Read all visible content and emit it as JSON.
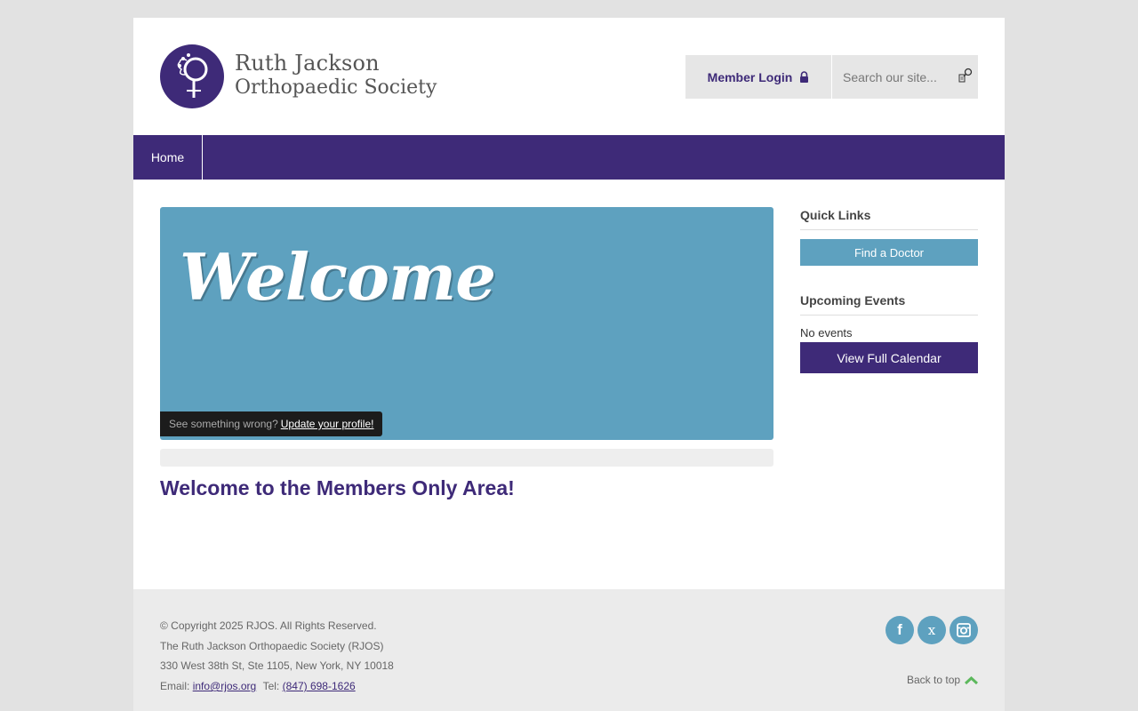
{
  "header": {
    "logo_title": "Ruth Jackson",
    "logo_subtitle": "Orthopaedic Society",
    "member_login_label": "Member Login",
    "search_placeholder": "Search our site..."
  },
  "nav": {
    "items": [
      {
        "label": "Home",
        "icon": "none"
      }
    ]
  },
  "banner": {
    "welcome_text": "Welcome",
    "notice_text": "See something wrong?",
    "notice_link": "Update your profile!"
  },
  "main": {
    "heading": "Welcome to the Members Only Area!"
  },
  "sidebar": {
    "quick_links_title": "Quick Links",
    "find_doctor_label": "Find a Doctor",
    "events_title": "Upcoming Events",
    "no_events_text": "No events",
    "view_calendar_label": "View Full Calendar"
  },
  "footer": {
    "copyright": "© Copyright 2025 RJOS. All Rights Reserved.",
    "org_name": "The Ruth Jackson Orthopaedic Society (RJOS)",
    "address": "330 West 38th St, Ste 1105, New York, NY 10018",
    "email_label": "Email:",
    "email": "info@rjos.org",
    "tel_label": "Tel:",
    "tel": "(847) 698-1626",
    "back_to_top": "Back to top",
    "social": [
      {
        "icon": "facebook-icon",
        "glyph": "f"
      },
      {
        "icon": "x-icon",
        "glyph": "x"
      },
      {
        "icon": "instagram-icon",
        "glyph": ""
      }
    ]
  },
  "colors": {
    "brand_purple": "#3e2a78",
    "accent_blue": "#5ea1bf",
    "background": "#e2e2e2",
    "back_top_chevron": "#5cb85c"
  }
}
